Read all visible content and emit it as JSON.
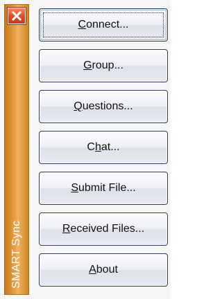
{
  "app": {
    "title": "SMART Sync"
  },
  "buttons": [
    {
      "id": "connect",
      "pre": "",
      "key": "C",
      "post": "onnect...",
      "focused": true
    },
    {
      "id": "group",
      "pre": "",
      "key": "G",
      "post": "roup...",
      "focused": false
    },
    {
      "id": "questions",
      "pre": "",
      "key": "Q",
      "post": "uestions...",
      "focused": false
    },
    {
      "id": "chat",
      "pre": "C",
      "key": "h",
      "post": "at...",
      "focused": false
    },
    {
      "id": "submit-file",
      "pre": "",
      "key": "S",
      "post": "ubmit File...",
      "focused": false
    },
    {
      "id": "received-files",
      "pre": "",
      "key": "R",
      "post": "eceived Files...",
      "focused": false
    },
    {
      "id": "about",
      "pre": "",
      "key": "A",
      "post": "bout",
      "focused": false
    }
  ],
  "colors": {
    "sidebar": "#e09a40",
    "close": "#e0502c",
    "button_border": "#2e3f56"
  },
  "icons": {
    "close": "close-icon"
  }
}
